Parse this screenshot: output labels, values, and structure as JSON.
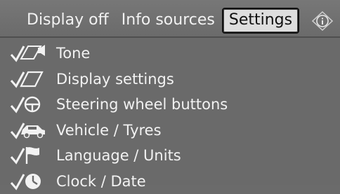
{
  "menu": {
    "tabs": [
      {
        "label": "Display off"
      },
      {
        "label": "Info sources"
      },
      {
        "label": "Settings",
        "selected": true
      }
    ],
    "info_icon": "info-icon"
  },
  "settings_items": [
    {
      "label": "Tone",
      "icon": "speaker-icon"
    },
    {
      "label": "Display settings",
      "icon": "display-icon"
    },
    {
      "label": "Steering wheel buttons",
      "icon": "steering-wheel-icon"
    },
    {
      "label": "Vehicle / Tyres",
      "icon": "car-icon"
    },
    {
      "label": "Language / Units",
      "icon": "flag-icon"
    },
    {
      "label": "Clock / Date",
      "icon": "clock-icon"
    }
  ],
  "colors": {
    "background": "#6b6b6b",
    "text": "#f2f2f2",
    "selected_tab_bg": "#dedede"
  }
}
